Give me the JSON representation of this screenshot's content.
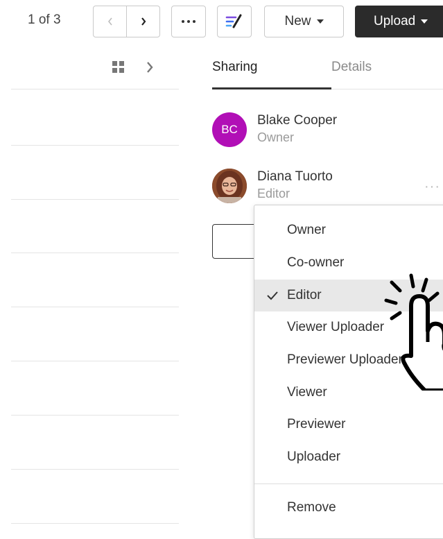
{
  "toolbar": {
    "page_indicator": "1 of 3",
    "new_label": "New",
    "upload_label": "Upload"
  },
  "tabs": [
    {
      "label": "Sharing",
      "active": true
    },
    {
      "label": "Details",
      "active": false
    }
  ],
  "collaborators": [
    {
      "initials": "BC",
      "name": "Blake Cooper",
      "role": "Owner",
      "avatar_color": "#b10fb6"
    },
    {
      "name": "Diana Tuorto",
      "role": "Editor"
    }
  ],
  "role_menu": {
    "items": [
      "Owner",
      "Co-owner",
      "Editor",
      "Viewer Uploader",
      "Previewer Uploader",
      "Viewer",
      "Previewer",
      "Uploader"
    ],
    "selected": "Editor",
    "remove_label": "Remove"
  },
  "colors": {
    "upload_button_bg": "#2b2b2b",
    "avatar_bc": "#b10fb6",
    "selected_item_bg": "#e8e8e8"
  }
}
